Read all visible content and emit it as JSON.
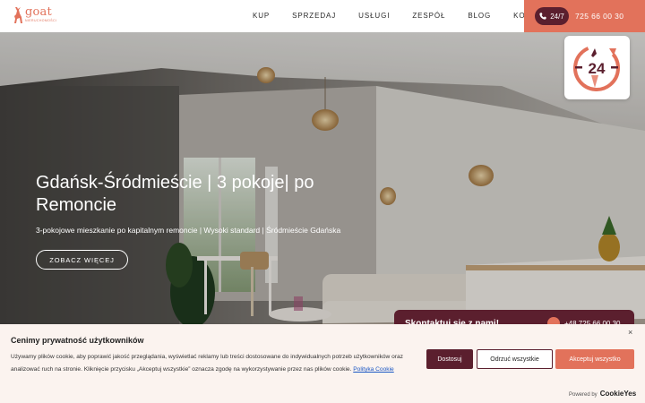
{
  "header": {
    "logo_word": "goat",
    "logo_sub": "NIERUCHOMOŚCI",
    "nav": [
      "KUP",
      "SPRZEDAJ",
      "USŁUGI",
      "ZESPÓŁ",
      "BLOG",
      "KONTAKT"
    ],
    "badge_247": "24/7",
    "phone": "725 66 00 30"
  },
  "hero": {
    "title": "Gdańsk-Śródmieście | 3 pokoje| po Remoncie",
    "subtitle": "3-pokojowe mieszkanie po kapitalnym remoncie | Wysoki standard | Śródmieście Gdańska",
    "button_label": "ZOBACZ WIĘCEJ",
    "badge_24_text": "24"
  },
  "contact_tab": {
    "label": "Skontaktuj się z nami!",
    "phone": "+48 725 66 00 30"
  },
  "cookie": {
    "title": "Cenimy prywatność użytkowników",
    "text": "Używamy plików cookie, aby poprawić jakość przeglądania, wyświetlać reklamy lub treści dostosowane do indywidualnych potrzeb użytkowników oraz analizować ruch na stronie. Kliknięcie przycisku „Akceptuj wszystkie” oznacza zgodę na wykorzystywanie przez nas plików cookie.",
    "link": "Polityka Cookie",
    "close": "×",
    "customize": "Dostosuj",
    "reject": "Odrzuć wszystkie",
    "accept": "Akceptuj wszystko",
    "powered_by": "Powered by",
    "powered_brand": "CookieYes"
  },
  "colors": {
    "accent": "#e2725b",
    "dark": "#5b1f2e",
    "cookie_bg": "#fbf3ef"
  }
}
